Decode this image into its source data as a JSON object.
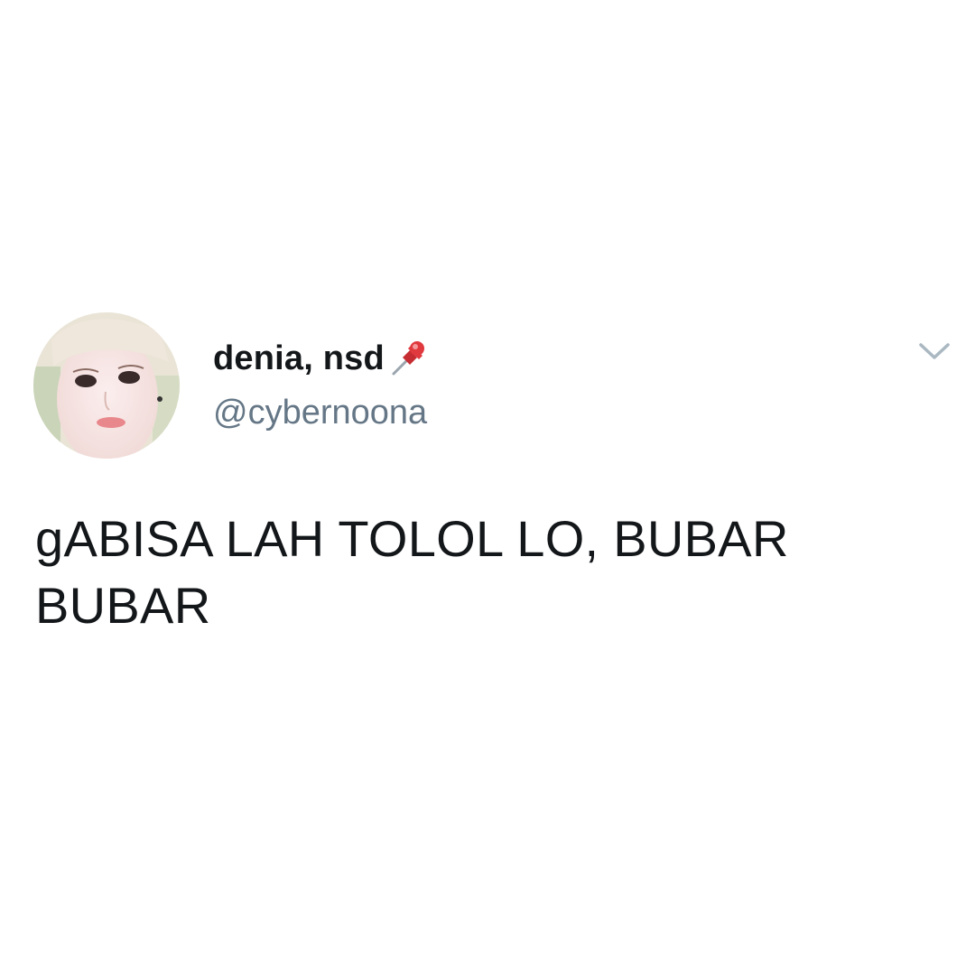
{
  "tweet": {
    "author": {
      "name": "denia, nsd",
      "handle": "@cybernoona",
      "badge_icon": "pushpin-icon",
      "avatar_icon": "profile-photo"
    },
    "menu_icon": "chevron-down-icon",
    "text": "gABISA LAH TOLOL LO, BUBAR BUBAR"
  },
  "colors": {
    "background": "#ffffff",
    "name": "#14171a",
    "handle": "#657786",
    "chevron": "#aab8c2",
    "pin": "#e0393e"
  }
}
